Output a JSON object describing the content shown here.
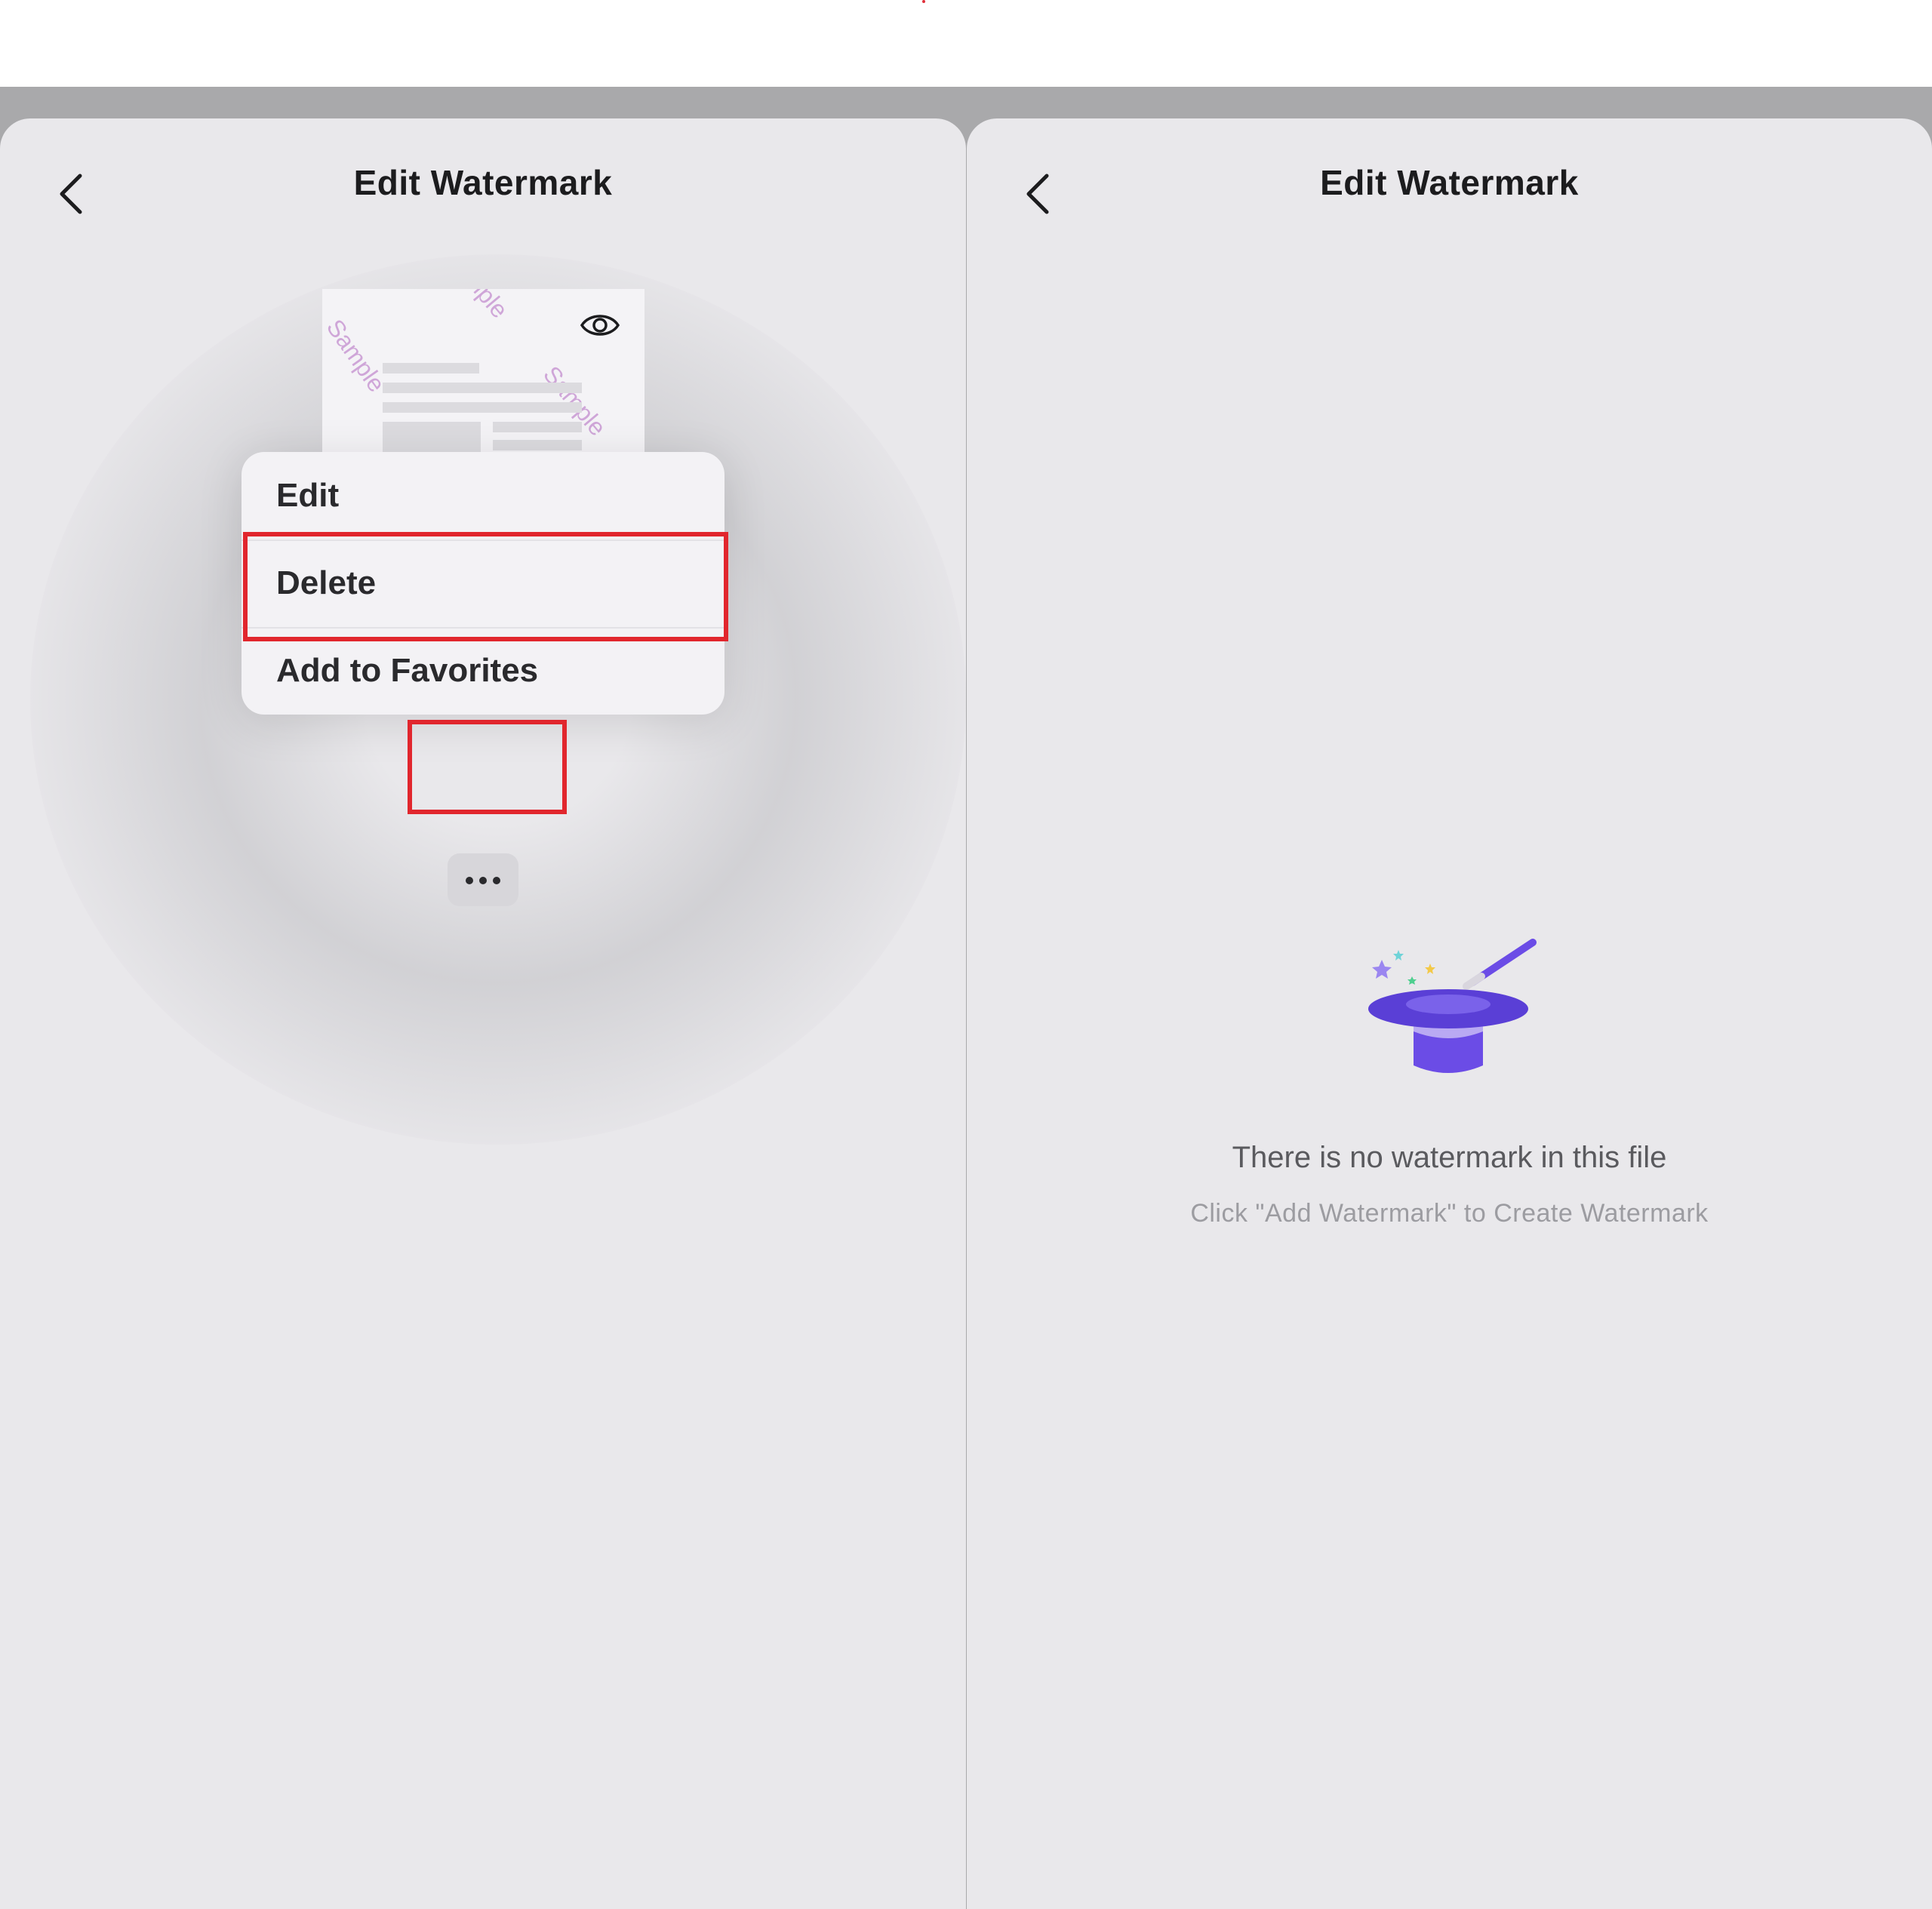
{
  "left_panel": {
    "title": "Edit Watermark",
    "thumbnail": {
      "watermark_text": "Sample",
      "eye_icon": "eye-icon"
    },
    "context_menu": {
      "items": [
        {
          "label": "Edit"
        },
        {
          "label": "Delete"
        },
        {
          "label": "Add to Favorites"
        }
      ]
    },
    "more_button_icon": "ellipsis-icon"
  },
  "right_panel": {
    "title": "Edit Watermark",
    "empty_state": {
      "title": "There is no watermark in this file",
      "subtitle": "Click \"Add Watermark\" to Create Watermark",
      "illustration": "magic-hat-icon"
    }
  },
  "colors": {
    "highlight": "#e1262d",
    "accent": "#6b4ce6",
    "watermark": "#cfa6d8"
  }
}
